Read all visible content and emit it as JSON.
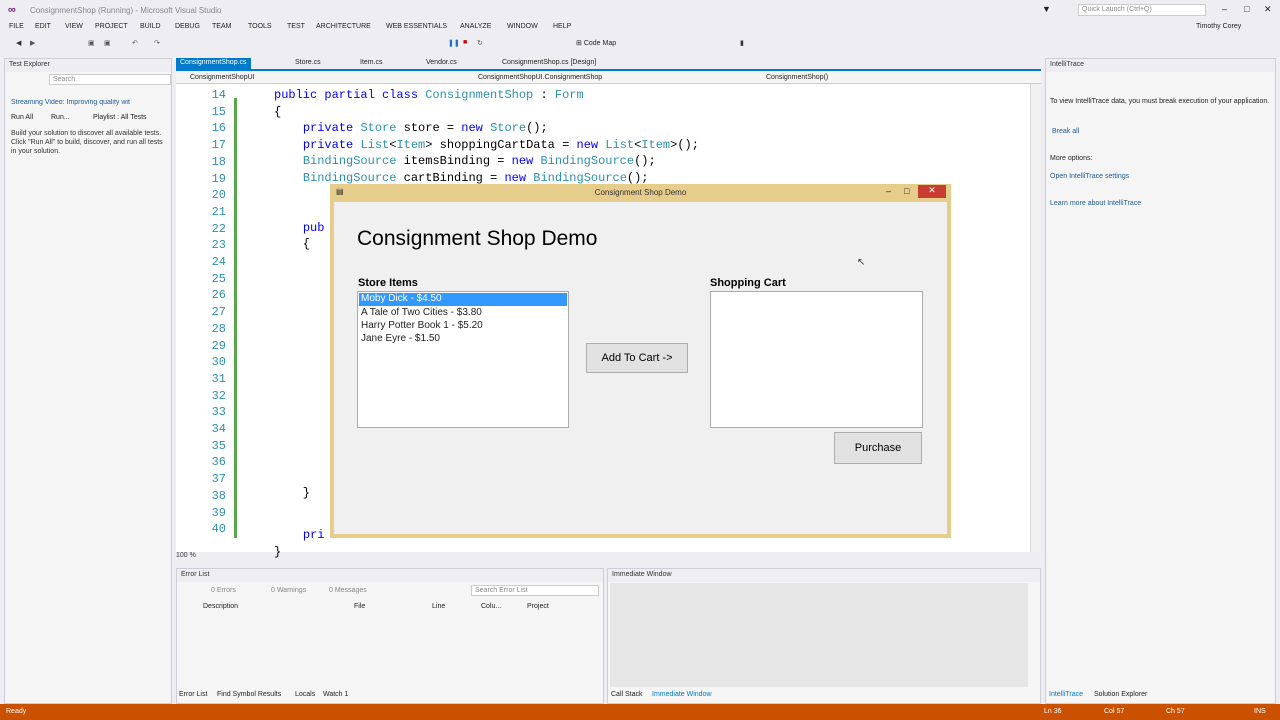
{
  "window": {
    "title": "ConsignmentShop (Running) - Microsoft Visual Studio",
    "quick_launch": "Quick Launch (Ctrl+Q)",
    "user": "Timothy Corey"
  },
  "menu": [
    "FILE",
    "EDIT",
    "VIEW",
    "PROJECT",
    "BUILD",
    "DEBUG",
    "TEAM",
    "TOOLS",
    "TEST",
    "ARCHITECTURE",
    "WEB ESSENTIALS",
    "ANALYZE",
    "WINDOW",
    "HELP"
  ],
  "toolbar": {
    "code_map": "Code Map"
  },
  "test_explorer": {
    "title": "Test Explorer",
    "search": "Search",
    "run_all": "Run All",
    "run": "Run...",
    "playlist": "Playlist : All Tests",
    "notice": "Streaming Video: Improving quality wit",
    "info": "Build your solution to discover all available tests. Click \"Run All\" to build, discover, and run all tests in your solution."
  },
  "tabs": [
    "ConsignmentShop.cs",
    "Store.cs",
    "Item.cs",
    "Vendor.cs",
    "ConsignmentShop.cs [Design]"
  ],
  "nav": {
    "project": "ConsignmentShopUI",
    "class": "ConsignmentShopUI.ConsignmentShop",
    "member": "ConsignmentShop()"
  },
  "code": {
    "lines": [
      "14",
      "15",
      "16",
      "17",
      "18",
      "19",
      "20",
      "21",
      "22",
      "23",
      "24",
      "25",
      "26",
      "27",
      "28",
      "29",
      "30",
      "31",
      "32",
      "33",
      "34",
      "35",
      "36",
      "37",
      "38",
      "39",
      "40"
    ],
    "zoom": "100 %"
  },
  "form": {
    "title": "Consignment Shop Demo",
    "heading": "Consignment Shop Demo",
    "store_label": "Store Items",
    "cart_label": "Shopping Cart",
    "items": [
      "Moby Dick - $4.50",
      "A Tale of Two Cities - $3.80",
      "Harry Potter Book 1 - $5.20",
      "Jane Eyre - $1.50"
    ],
    "add_button": "Add To Cart ->",
    "purchase_button": "Purchase"
  },
  "error_list": {
    "title": "Error List",
    "errors": "0 Errors",
    "warnings": "0 Warnings",
    "messages": "0 Messages",
    "search": "Search Error List",
    "cols": [
      "Description",
      "File",
      "Line",
      "Colu...",
      "Project"
    ],
    "bottom_tabs": [
      "Error List",
      "Find Symbol Results",
      "Locals",
      "Watch 1"
    ]
  },
  "immediate": {
    "title": "Immediate Window",
    "bottom_tabs": [
      "Call Stack",
      "Immediate Window"
    ]
  },
  "intellitrace": {
    "title": "IntelliTrace",
    "desc": "To view IntelliTrace data, you must break execution of your application.",
    "break_all": "Break all",
    "more": "More options:",
    "settings": "Open IntelliTrace settings",
    "learn": "Learn more about IntelliTrace",
    "bottom_tabs": [
      "IntelliTrace",
      "Solution Explorer"
    ]
  },
  "status": {
    "left": "Ready",
    "ln": "Ln 36",
    "col": "Col 57",
    "ch": "Ch 57",
    "ins": "INS"
  }
}
